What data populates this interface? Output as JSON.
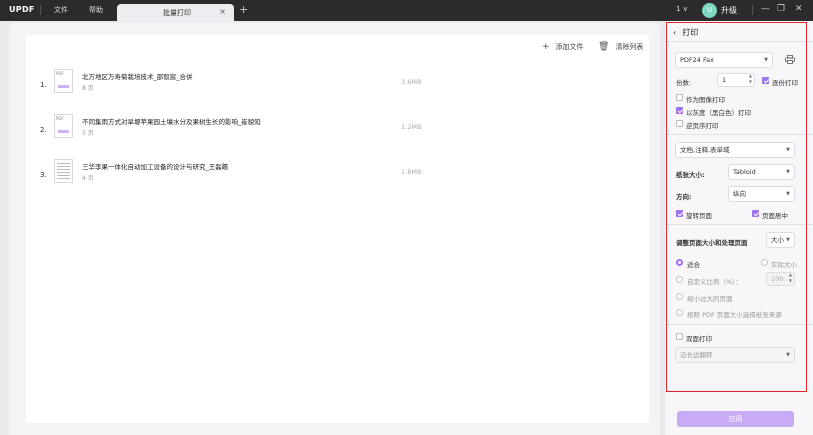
{
  "titlebar": {
    "logo": "UPDF",
    "menu": [
      "文件",
      "帮助"
    ],
    "tab_title": "批量打印",
    "tab_close": "×",
    "tab_add": "+",
    "page_indicator": "1",
    "page_chevron": "∨",
    "avatar_letter": "U",
    "upgrade_label": "升级",
    "minimize": "—",
    "restore": "❐",
    "close": "✕"
  },
  "toolbar": {
    "add_file_icon": "+",
    "add_file_label": "添加文件",
    "clear_icon": "🗑",
    "clear_label": "清除列表"
  },
  "files": [
    {
      "index": "1.",
      "thumb": "PDF",
      "name": "北方地区万寿菊栽培技术_邵智宸_合併",
      "pages": "8 页",
      "size": "3.6MB"
    },
    {
      "index": "2.",
      "thumb": "PDF",
      "name": "不同集雨方式对旱塬苹果园土壤水分及果树生长的影响_崔貌陷",
      "pages": "5 页",
      "size": "1.2MB"
    },
    {
      "index": "3.",
      "thumb": "",
      "name": "三华李果一体化自动加工设备的设计与研究_王磊瞻",
      "pages": "4 页",
      "size": "1.8MB"
    }
  ],
  "panel": {
    "back": "‹",
    "title": "打印",
    "printer": "PDF24 Fax",
    "copies_label": "份数:",
    "copies_value": "1",
    "collate_label": "逐份打印",
    "print_as_image": "作为图像打印",
    "print_grayscale": "以灰度（黑白色）打印",
    "reverse_print": "逆页序打印",
    "content": "文档,注释,表单域",
    "paper_size_label": "纸张大小:",
    "paper_size_value": "Tabloid",
    "orientation_label": "方向:",
    "orientation_value": "纵向",
    "auto_rotate": "旋转页面",
    "center_page": "页面居中",
    "scaling_title": "调整页面大小和处理页面",
    "scaling_mode": "大小",
    "fit": "适合",
    "actual_size": "实际大小",
    "custom_scale_label": "自定义比例（%）：",
    "custom_scale_value": "100",
    "shrink_oversized": "缩小过大的页面",
    "choose_paper_by_pdf": "按照 PDF 页面大小选择纸张来源",
    "duplex": "双面打印",
    "flip_edge": "沿长边翻转",
    "apply": "应用"
  },
  "colors": {
    "accent": "#9b72f0",
    "highlight": "#e0252b",
    "titlebar": "#2b2b2e"
  }
}
